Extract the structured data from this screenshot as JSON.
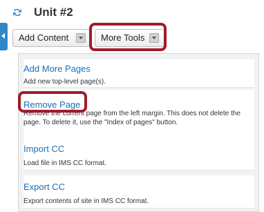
{
  "unit": {
    "title": "Unit #2",
    "reorder_icon": "reorder-arrows-icon"
  },
  "collapse_tab": {
    "icon": "collapse-left-arrow-icon",
    "color": "#2f86c9"
  },
  "toolbar": {
    "add_content_label": "Add Content",
    "more_tools_label": "More Tools",
    "dropdown_icon": "chevron-down-icon"
  },
  "highlight_color": "#a11a2c",
  "menu": {
    "items": [
      {
        "name": "Add More Pages",
        "description": "Add new top-level page(s)."
      },
      {
        "name": "Remove Page",
        "description": "Remove the current page from the left margin. This does not delete the page. To delete it, use the \"Index of pages\" button."
      },
      {
        "name": "Import CC",
        "description": "Load file in IMS CC format."
      },
      {
        "name": "Export CC",
        "description": "Export contents of site in IMS CC format."
      }
    ]
  },
  "colors": {
    "link": "#1a6fb8",
    "text": "#333333"
  }
}
